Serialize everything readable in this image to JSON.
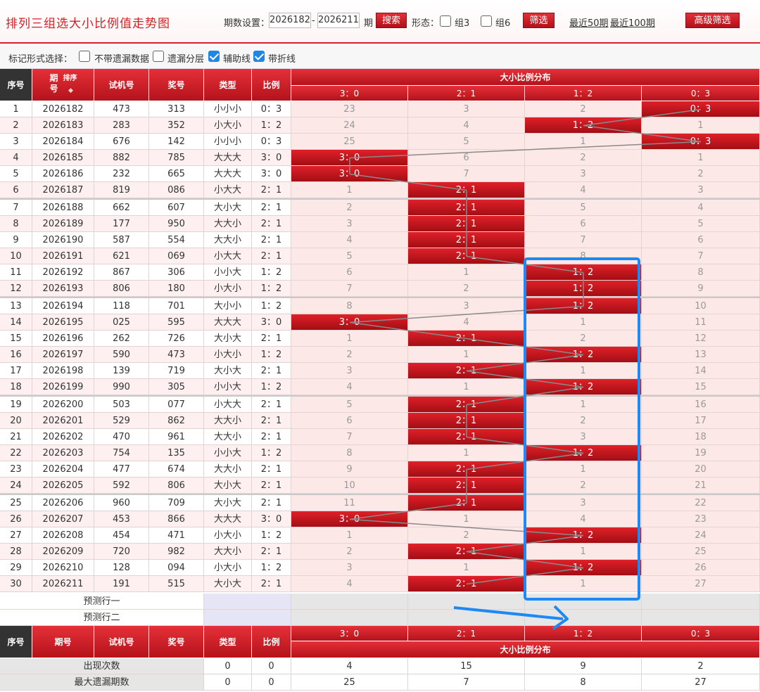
{
  "header": {
    "title": "排列三组选大小比例值走势图",
    "period_label": "期数设置：",
    "from": "2026182",
    "dash": "-",
    "to": "2026211",
    "qi": "期",
    "search": "搜索",
    "form_label": "形态：",
    "g3": "组3",
    "g6": "组6",
    "filter": "筛选",
    "last50": "最近50期",
    "last100": "最近100期",
    "advanced": "高级筛选"
  },
  "mark": {
    "label": "标记形式选择：",
    "opt1": "不带遗漏数据",
    "opt2": "遗漏分层",
    "opt3": "辅助线",
    "opt4": "带折线",
    "opt3_checked": true,
    "opt4_checked": true
  },
  "table": {
    "headers": {
      "seq": "序号",
      "period": "期号",
      "sort": "排序",
      "trial": "试机号",
      "prize": "奖号",
      "type": "类型",
      "ratio": "比例",
      "dist": "大小比例分布"
    },
    "dist_cols": [
      "3：0",
      "2：1",
      "1：2",
      "0：3"
    ],
    "rows": [
      {
        "seq": "1",
        "period": "2026182",
        "trial": "473",
        "prize": "313",
        "type": "小小小",
        "ratio": "0：3",
        "hit": 3,
        "cells": [
          "23",
          "3",
          "2",
          "0：3"
        ]
      },
      {
        "seq": "2",
        "period": "2026183",
        "trial": "283",
        "prize": "352",
        "type": "小大小",
        "ratio": "1：2",
        "hit": 2,
        "cells": [
          "24",
          "4",
          "1：2",
          "1"
        ]
      },
      {
        "seq": "3",
        "period": "2026184",
        "trial": "676",
        "prize": "142",
        "type": "小小小",
        "ratio": "0：3",
        "hit": 3,
        "cells": [
          "25",
          "5",
          "1",
          "0：3"
        ]
      },
      {
        "seq": "4",
        "period": "2026185",
        "trial": "882",
        "prize": "785",
        "type": "大大大",
        "ratio": "3：0",
        "hit": 0,
        "cells": [
          "3：0",
          "6",
          "2",
          "1"
        ]
      },
      {
        "seq": "5",
        "period": "2026186",
        "trial": "232",
        "prize": "665",
        "type": "大大大",
        "ratio": "3：0",
        "hit": 0,
        "cells": [
          "3：0",
          "7",
          "3",
          "2"
        ]
      },
      {
        "seq": "6",
        "period": "2026187",
        "trial": "819",
        "prize": "086",
        "type": "小大大",
        "ratio": "2：1",
        "hit": 1,
        "cells": [
          "1",
          "2：1",
          "4",
          "3"
        ]
      },
      {
        "seq": "7",
        "period": "2026188",
        "trial": "662",
        "prize": "607",
        "type": "大小大",
        "ratio": "2：1",
        "hit": 1,
        "cells": [
          "2",
          "2：1",
          "5",
          "4"
        ]
      },
      {
        "seq": "8",
        "period": "2026189",
        "trial": "177",
        "prize": "950",
        "type": "大大小",
        "ratio": "2：1",
        "hit": 1,
        "cells": [
          "3",
          "2：1",
          "6",
          "5"
        ]
      },
      {
        "seq": "9",
        "period": "2026190",
        "trial": "587",
        "prize": "554",
        "type": "大大小",
        "ratio": "2：1",
        "hit": 1,
        "cells": [
          "4",
          "2：1",
          "7",
          "6"
        ]
      },
      {
        "seq": "10",
        "period": "2026191",
        "trial": "621",
        "prize": "069",
        "type": "小大大",
        "ratio": "2：1",
        "hit": 1,
        "cells": [
          "5",
          "2：1",
          "8",
          "7"
        ]
      },
      {
        "seq": "11",
        "period": "2026192",
        "trial": "867",
        "prize": "306",
        "type": "小小大",
        "ratio": "1：2",
        "hit": 2,
        "cells": [
          "6",
          "1",
          "1：2",
          "8"
        ]
      },
      {
        "seq": "12",
        "period": "2026193",
        "trial": "806",
        "prize": "180",
        "type": "小大小",
        "ratio": "1：2",
        "hit": 2,
        "cells": [
          "7",
          "2",
          "1：2",
          "9"
        ]
      },
      {
        "seq": "13",
        "period": "2026194",
        "trial": "118",
        "prize": "701",
        "type": "大小小",
        "ratio": "1：2",
        "hit": 2,
        "cells": [
          "8",
          "3",
          "1：2",
          "10"
        ]
      },
      {
        "seq": "14",
        "period": "2026195",
        "trial": "025",
        "prize": "595",
        "type": "大大大",
        "ratio": "3：0",
        "hit": 0,
        "cells": [
          "3：0",
          "4",
          "1",
          "11"
        ]
      },
      {
        "seq": "15",
        "period": "2026196",
        "trial": "262",
        "prize": "726",
        "type": "大小大",
        "ratio": "2：1",
        "hit": 1,
        "cells": [
          "1",
          "2：1",
          "2",
          "12"
        ]
      },
      {
        "seq": "16",
        "period": "2026197",
        "trial": "590",
        "prize": "473",
        "type": "小大小",
        "ratio": "1：2",
        "hit": 2,
        "cells": [
          "2",
          "1",
          "1：2",
          "13"
        ]
      },
      {
        "seq": "17",
        "period": "2026198",
        "trial": "139",
        "prize": "719",
        "type": "大小大",
        "ratio": "2：1",
        "hit": 1,
        "cells": [
          "3",
          "2：1",
          "1",
          "14"
        ]
      },
      {
        "seq": "18",
        "period": "2026199",
        "trial": "990",
        "prize": "305",
        "type": "小小大",
        "ratio": "1：2",
        "hit": 2,
        "cells": [
          "4",
          "1",
          "1：2",
          "15"
        ]
      },
      {
        "seq": "19",
        "period": "2026200",
        "trial": "503",
        "prize": "077",
        "type": "小大大",
        "ratio": "2：1",
        "hit": 1,
        "cells": [
          "5",
          "2：1",
          "1",
          "16"
        ]
      },
      {
        "seq": "20",
        "period": "2026201",
        "trial": "529",
        "prize": "862",
        "type": "大大小",
        "ratio": "2：1",
        "hit": 1,
        "cells": [
          "6",
          "2：1",
          "2",
          "17"
        ]
      },
      {
        "seq": "21",
        "period": "2026202",
        "trial": "470",
        "prize": "961",
        "type": "大大小",
        "ratio": "2：1",
        "hit": 1,
        "cells": [
          "7",
          "2：1",
          "3",
          "18"
        ]
      },
      {
        "seq": "22",
        "period": "2026203",
        "trial": "754",
        "prize": "135",
        "type": "小小大",
        "ratio": "1：2",
        "hit": 2,
        "cells": [
          "8",
          "1",
          "1：2",
          "19"
        ]
      },
      {
        "seq": "23",
        "period": "2026204",
        "trial": "477",
        "prize": "674",
        "type": "大大小",
        "ratio": "2：1",
        "hit": 1,
        "cells": [
          "9",
          "2：1",
          "1",
          "20"
        ]
      },
      {
        "seq": "24",
        "period": "2026205",
        "trial": "592",
        "prize": "806",
        "type": "大小大",
        "ratio": "2：1",
        "hit": 1,
        "cells": [
          "10",
          "2：1",
          "2",
          "21"
        ]
      },
      {
        "seq": "25",
        "period": "2026206",
        "trial": "960",
        "prize": "709",
        "type": "大小大",
        "ratio": "2：1",
        "hit": 1,
        "cells": [
          "11",
          "2：1",
          "3",
          "22"
        ]
      },
      {
        "seq": "26",
        "period": "2026207",
        "trial": "453",
        "prize": "866",
        "type": "大大大",
        "ratio": "3：0",
        "hit": 0,
        "cells": [
          "3：0",
          "1",
          "4",
          "23"
        ]
      },
      {
        "seq": "27",
        "period": "2026208",
        "trial": "454",
        "prize": "471",
        "type": "小大小",
        "ratio": "1：2",
        "hit": 2,
        "cells": [
          "1",
          "2",
          "1：2",
          "24"
        ]
      },
      {
        "seq": "28",
        "period": "2026209",
        "trial": "720",
        "prize": "982",
        "type": "大大小",
        "ratio": "2：1",
        "hit": 1,
        "cells": [
          "2",
          "2：1",
          "1",
          "25"
        ]
      },
      {
        "seq": "29",
        "period": "2026210",
        "trial": "128",
        "prize": "094",
        "type": "小大小",
        "ratio": "1：2",
        "hit": 2,
        "cells": [
          "3",
          "1",
          "1：2",
          "26"
        ]
      },
      {
        "seq": "30",
        "period": "2026211",
        "trial": "191",
        "prize": "515",
        "type": "大小大",
        "ratio": "2：1",
        "hit": 1,
        "cells": [
          "4",
          "2：1",
          "1",
          "27"
        ]
      }
    ],
    "predict1": "预测行一",
    "predict2": "预测行二",
    "stats": [
      {
        "label": "出现次数",
        "type": "0",
        "ratio": "0",
        "vals": [
          "4",
          "15",
          "9",
          "2"
        ]
      },
      {
        "label": "最大遗漏期数",
        "type": "0",
        "ratio": "0",
        "vals": [
          "25",
          "7",
          "8",
          "27"
        ]
      }
    ]
  },
  "colors": {
    "accent": "#d81f26",
    "highlight": "#1e88f5"
  }
}
